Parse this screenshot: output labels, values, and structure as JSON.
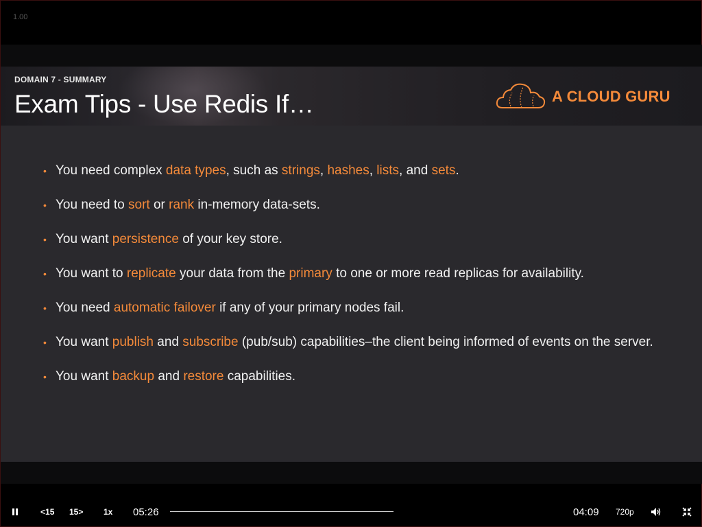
{
  "player": {
    "version": "1.00"
  },
  "slide": {
    "eyebrow": "DOMAIN 7 - SUMMARY",
    "title": "Exam Tips - Use Redis If…",
    "logo_text": "A CLOUD GURU",
    "bullets": [
      {
        "parts": [
          {
            "text": "You need complex ",
            "hl": false
          },
          {
            "text": "data types",
            "hl": true
          },
          {
            "text": ", such as ",
            "hl": false
          },
          {
            "text": "strings",
            "hl": true
          },
          {
            "text": ", ",
            "hl": false
          },
          {
            "text": "hashes",
            "hl": true
          },
          {
            "text": ", ",
            "hl": false
          },
          {
            "text": "lists",
            "hl": true
          },
          {
            "text": ", and ",
            "hl": false
          },
          {
            "text": "sets",
            "hl": true
          },
          {
            "text": ".",
            "hl": false
          }
        ]
      },
      {
        "parts": [
          {
            "text": "You need to ",
            "hl": false
          },
          {
            "text": "sort",
            "hl": true
          },
          {
            "text": " or ",
            "hl": false
          },
          {
            "text": "rank",
            "hl": true
          },
          {
            "text": " in-memory data-sets.",
            "hl": false
          }
        ]
      },
      {
        "parts": [
          {
            "text": "You want ",
            "hl": false
          },
          {
            "text": "persistence",
            "hl": true
          },
          {
            "text": " of your key store.",
            "hl": false
          }
        ]
      },
      {
        "parts": [
          {
            "text": "You want to ",
            "hl": false
          },
          {
            "text": "replicate",
            "hl": true
          },
          {
            "text": " your data from the ",
            "hl": false
          },
          {
            "text": "primary",
            "hl": true
          },
          {
            "text": " to one or more read replicas for availability.",
            "hl": false
          }
        ]
      },
      {
        "parts": [
          {
            "text": "You need ",
            "hl": false
          },
          {
            "text": "automatic failover",
            "hl": true
          },
          {
            "text": " if any of your primary nodes fail.",
            "hl": false
          }
        ]
      },
      {
        "parts": [
          {
            "text": "You want ",
            "hl": false
          },
          {
            "text": "publish",
            "hl": true
          },
          {
            "text": " and ",
            "hl": false
          },
          {
            "text": "subscribe",
            "hl": true
          },
          {
            "text": " (pub/sub) capabilities–the client being informed of events on the server.",
            "hl": false
          }
        ]
      },
      {
        "parts": [
          {
            "text": "You want ",
            "hl": false
          },
          {
            "text": "backup",
            "hl": true
          },
          {
            "text": " and ",
            "hl": false
          },
          {
            "text": "restore",
            "hl": true
          },
          {
            "text": " capabilities.",
            "hl": false
          }
        ]
      }
    ]
  },
  "controls": {
    "play_pause_icon": "pause-icon",
    "rewind_label": "15",
    "forward_label": "15",
    "speed_label": "1x",
    "current_time": "05:26",
    "remaining_time": "04:09",
    "quality_label": "720p",
    "volume_icon": "volume-icon",
    "exit_fullscreen_icon": "exit-fullscreen-icon"
  },
  "colors": {
    "accent": "#f48a3a",
    "slide_bg": "#2a292d"
  }
}
